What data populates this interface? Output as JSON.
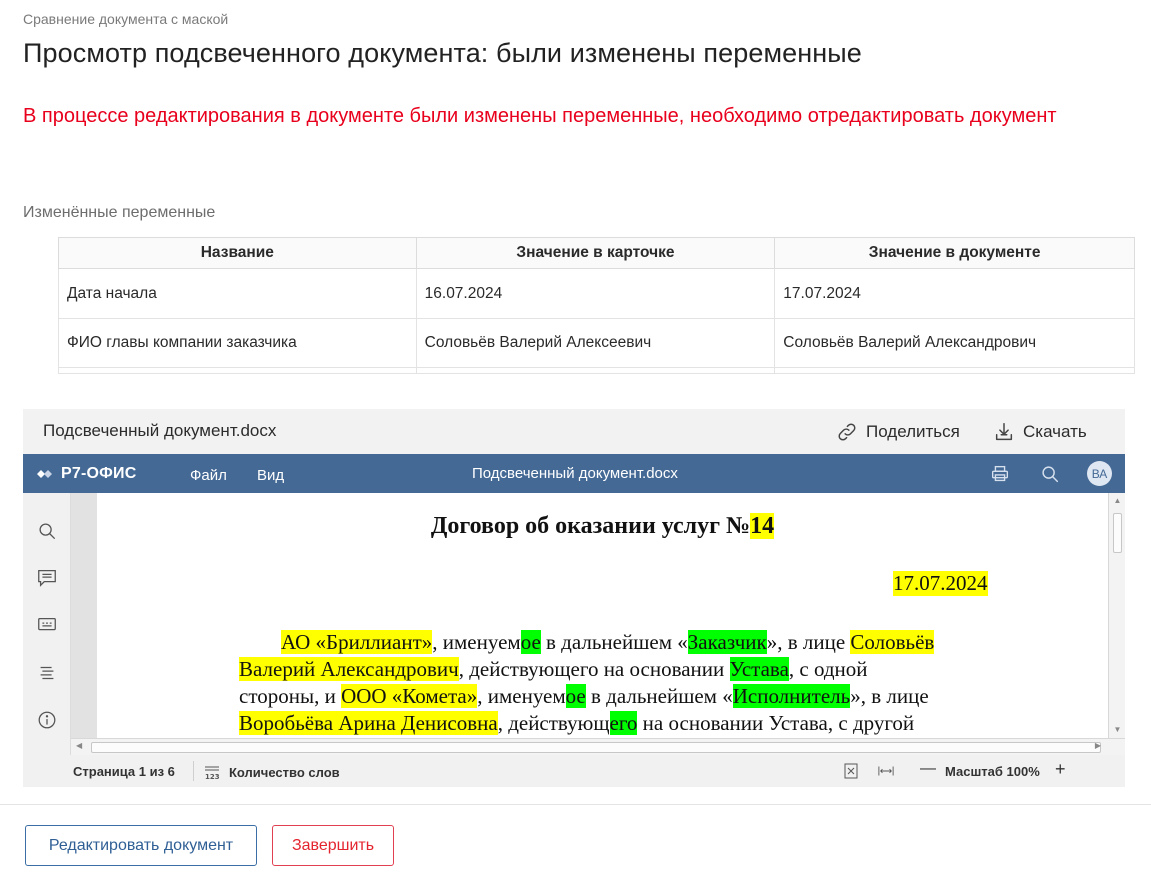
{
  "breadcrumb": "Сравнение документа с маской",
  "title": "Просмотр подсвеченного документа: были изменены переменные",
  "warning": "В процессе редактирования в документе были изменены переменные, необходимо отредактировать документ",
  "changed_section_label": "Изменённые переменные",
  "table": {
    "headers": [
      "Название",
      "Значение в карточке",
      "Значение в документе"
    ],
    "rows": [
      [
        "Дата начала",
        "16.07.2024",
        "17.07.2024"
      ],
      [
        "ФИО главы компании заказчика",
        "Соловьёв Валерий Алексеевич",
        "Соловьёв Валерий Александрович"
      ]
    ]
  },
  "viewer": {
    "file_name": "Подсвеченный документ.docx",
    "share_label": "Поделиться",
    "download_label": "Скачать",
    "editor": {
      "logo": "Р7-ОФИС",
      "menu": [
        "Файл",
        "Вид"
      ],
      "doc_title": "Подсвеченный документ.docx",
      "avatar_initials": "ВА",
      "icons": [
        "print-icon",
        "search-icon"
      ],
      "rail_icons": [
        "search-icon",
        "comment-icon",
        "chat-icon",
        "navigation-icon",
        "info-icon"
      ]
    },
    "document": {
      "title_text": "Договор об оказании услуг №",
      "title_number": "14",
      "date": "17.07.2024",
      "lines": [
        [
          [
            "АО «Бриллиант»",
            "yl"
          ],
          [
            ", именуем",
            ""
          ],
          [
            "ое",
            "gn"
          ],
          [
            " в дальнейшем «",
            ""
          ],
          [
            "Заказчик",
            "gn"
          ],
          [
            "», в лице ",
            ""
          ],
          [
            "Соловьёв",
            "yl"
          ]
        ],
        [
          [
            "Валерий Александрович",
            "yl"
          ],
          [
            ", действующего на основании ",
            ""
          ],
          [
            "Устава",
            "gn"
          ],
          [
            ", с одной",
            ""
          ]
        ],
        [
          [
            "стороны, и ",
            ""
          ],
          [
            "ООО «Комета»",
            "yl"
          ],
          [
            ", именуем",
            ""
          ],
          [
            "ое",
            "gn"
          ],
          [
            " в дальнейшем «",
            ""
          ],
          [
            "Исполнитель",
            "gn"
          ],
          [
            "», в лице",
            ""
          ]
        ],
        [
          [
            "Воробьёва Арина Денисовна",
            "yl"
          ],
          [
            ", действующ",
            ""
          ],
          [
            "его",
            "gn"
          ],
          [
            " на основании Устава, с другой",
            ""
          ]
        ]
      ]
    },
    "status": {
      "page": "Страница 1 из 6",
      "word_count": "Количество слов",
      "zoom": "Масштаб 100%"
    }
  },
  "buttons": {
    "edit": "Редактировать документ",
    "finish": "Завершить"
  },
  "colors": {
    "warning": "#e8001c",
    "editor_bar": "#446995",
    "highlight_variable": "#ffff00",
    "highlight_change": "#00ff00",
    "primary_button": "#2f5f95",
    "danger_button": "#e4252f"
  }
}
